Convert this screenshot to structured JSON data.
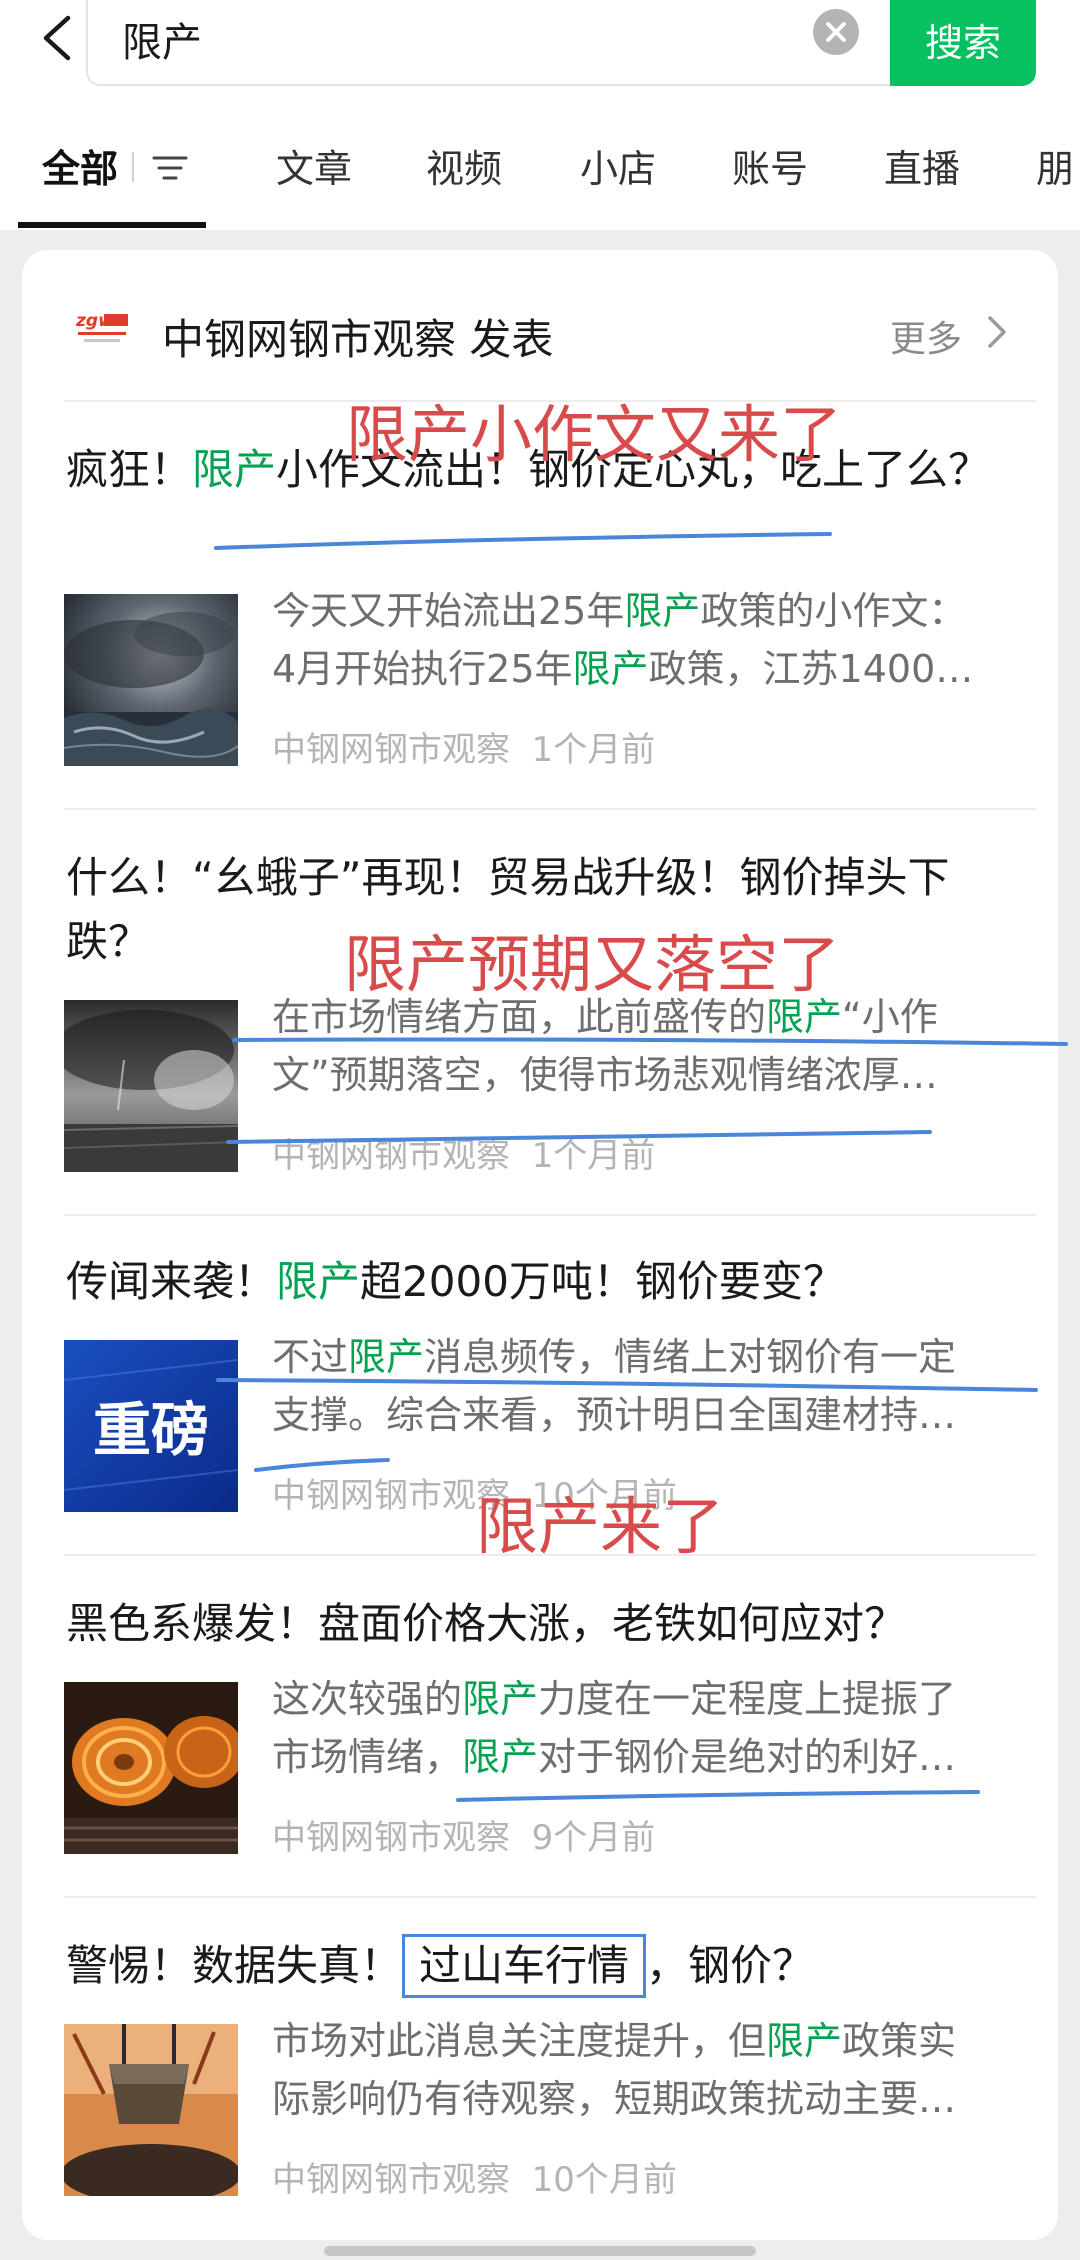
{
  "search": {
    "query": "限产",
    "button_label": "搜索"
  },
  "tabs": [
    {
      "label": "全部"
    },
    {
      "label": "文章"
    },
    {
      "label": "视频"
    },
    {
      "label": "小店"
    },
    {
      "label": "账号"
    },
    {
      "label": "直播"
    },
    {
      "label": "朋"
    }
  ],
  "account": {
    "logo_text": "zgw",
    "name": "中钢网钢市观察 发表",
    "more_label": "更多"
  },
  "items": [
    {
      "title_pre": "疯狂！",
      "title_hl": "限产",
      "title_post": "小作文流出！钢价定心丸，吃上了么？",
      "snippet_line1_pre": "今天又开始流出25年",
      "snippet_line1_hl": "限产",
      "snippet_line1_post": "政策的小作文：",
      "snippet_line2_pre": "4月开始执行25年",
      "snippet_line2_hl": "限产",
      "snippet_line2_post": "政策，江苏1400…",
      "source": "中钢网钢市观察",
      "time": "1个月前"
    },
    {
      "title_pre": "什么！“幺蛾子”再现！贸易战升级！钢价掉头下跌？",
      "title_hl": "",
      "title_post": "",
      "snippet_line1_pre": "在市场情绪方面，此前盛传的",
      "snippet_line1_hl": "限产",
      "snippet_line1_post": "“小作",
      "snippet_line2_pre": "文”预期落空，使得市场悲观情绪浓厚…",
      "snippet_line2_hl": "",
      "snippet_line2_post": "",
      "source": "中钢网钢市观察",
      "time": "1个月前"
    },
    {
      "title_pre": "传闻来袭！",
      "title_hl": "限产",
      "title_post": "超2000万吨！钢价要变？",
      "snippet_line1_pre": "不过",
      "snippet_line1_hl": "限产",
      "snippet_line1_post": "消息频传，情绪上对钢价有一定",
      "snippet_line2_pre": "支撑。综合来看，预计明日全国建材持…",
      "snippet_line2_hl": "",
      "snippet_line2_post": "",
      "thumb_text": "重磅",
      "source": "中钢网钢市观察",
      "time": "10个月前"
    },
    {
      "title_pre": "黑色系爆发！盘面价格大涨，老铁如何应对？",
      "title_hl": "",
      "title_post": "",
      "snippet_line1_pre": "这次较强的",
      "snippet_line1_hl": "限产",
      "snippet_line1_post": "力度在一定程度上提振了",
      "snippet_line2_pre": "市场情绪，",
      "snippet_line2_hl": "限产",
      "snippet_line2_post": "对于钢价是绝对的利好…",
      "source": "中钢网钢市观察",
      "time": "9个月前"
    },
    {
      "title_pre": "警惕！数据失真！",
      "title_box": "过山车行情",
      "title_post": "，钢价？",
      "snippet_line1_pre": "市场对此消息关注度提升，但",
      "snippet_line1_hl": "限产",
      "snippet_line1_post": "政策实",
      "snippet_line2_pre": "际影响仍有待观察，短期政策扰动主要…",
      "snippet_line2_hl": "",
      "snippet_line2_post": "",
      "source": "中钢网钢市观察",
      "time": "10个月前"
    }
  ],
  "annotations": {
    "a1": "限产小作文又来了",
    "a2": "限产预期又落空了",
    "a3": "限产来了"
  },
  "colors": {
    "accent_green": "#07c160",
    "highlight_green": "#07a152",
    "annotation_red": "#d94a4a",
    "annotation_blue": "#4a86d9"
  }
}
